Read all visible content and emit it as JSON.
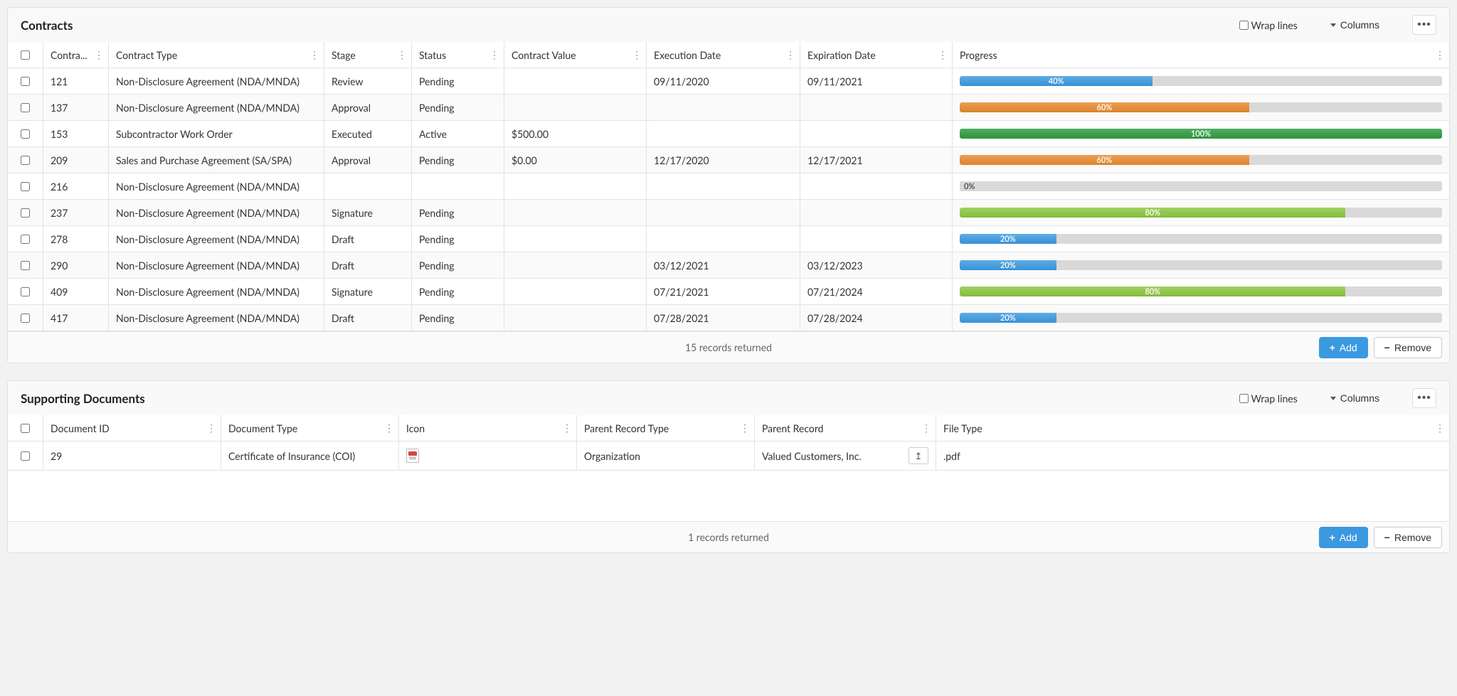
{
  "common": {
    "wrap_lines_label": "Wrap lines",
    "columns_label": "Columns",
    "more_label": "•••",
    "add_label": "Add",
    "remove_label": "Remove"
  },
  "contracts": {
    "title": "Contracts",
    "columns": {
      "id": "Contra...",
      "type": "Contract Type",
      "stage": "Stage",
      "status": "Status",
      "value": "Contract Value",
      "exec": "Execution Date",
      "exp": "Expiration Date",
      "progress": "Progress"
    },
    "rows": [
      {
        "id": "121",
        "type": "Non-Disclosure Agreement (NDA/MNDA)",
        "stage": "Review",
        "status": "Pending",
        "value": "",
        "exec": "09/11/2020",
        "exp": "09/11/2021",
        "progress": 40,
        "color": "#3b99e0"
      },
      {
        "id": "137",
        "type": "Non-Disclosure Agreement (NDA/MNDA)",
        "stage": "Approval",
        "status": "Pending",
        "value": "",
        "exec": "",
        "exp": "",
        "progress": 60,
        "color": "#e78a2e"
      },
      {
        "id": "153",
        "type": "Subcontractor Work Order",
        "stage": "Executed",
        "status": "Active",
        "value": "$500.00",
        "exec": "",
        "exp": "",
        "progress": 100,
        "color": "#2e9b3f"
      },
      {
        "id": "209",
        "type": "Sales and Purchase Agreement (SA/SPA)",
        "stage": "Approval",
        "status": "Pending",
        "value": "$0.00",
        "exec": "12/17/2020",
        "exp": "12/17/2021",
        "progress": 60,
        "color": "#e78a2e"
      },
      {
        "id": "216",
        "type": "Non-Disclosure Agreement (NDA/MNDA)",
        "stage": "",
        "status": "",
        "value": "",
        "exec": "",
        "exp": "",
        "progress": 0,
        "color": "#d9d9d9"
      },
      {
        "id": "237",
        "type": "Non-Disclosure Agreement (NDA/MNDA)",
        "stage": "Signature",
        "status": "Pending",
        "value": "",
        "exec": "",
        "exp": "",
        "progress": 80,
        "color": "#8bc63f"
      },
      {
        "id": "278",
        "type": "Non-Disclosure Agreement (NDA/MNDA)",
        "stage": "Draft",
        "status": "Pending",
        "value": "",
        "exec": "",
        "exp": "",
        "progress": 20,
        "color": "#3b99e0"
      },
      {
        "id": "290",
        "type": "Non-Disclosure Agreement (NDA/MNDA)",
        "stage": "Draft",
        "status": "Pending",
        "value": "",
        "exec": "03/12/2021",
        "exp": "03/12/2023",
        "progress": 20,
        "color": "#3b99e0"
      },
      {
        "id": "409",
        "type": "Non-Disclosure Agreement (NDA/MNDA)",
        "stage": "Signature",
        "status": "Pending",
        "value": "",
        "exec": "07/21/2021",
        "exp": "07/21/2024",
        "progress": 80,
        "color": "#8bc63f"
      },
      {
        "id": "417",
        "type": "Non-Disclosure Agreement (NDA/MNDA)",
        "stage": "Draft",
        "status": "Pending",
        "value": "",
        "exec": "07/28/2021",
        "exp": "07/28/2024",
        "progress": 20,
        "color": "#3b99e0"
      }
    ],
    "footer": "15 records returned"
  },
  "documents": {
    "title": "Supporting Documents",
    "columns": {
      "id": "Document ID",
      "type": "Document Type",
      "icon": "Icon",
      "prt": "Parent Record Type",
      "pr": "Parent Record",
      "ft": "File Type"
    },
    "rows": [
      {
        "id": "29",
        "type": "Certificate of Insurance (COI)",
        "prt": "Organization",
        "pr": "Valued Customers, Inc.",
        "ft": ".pdf"
      }
    ],
    "footer": "1 records returned"
  }
}
